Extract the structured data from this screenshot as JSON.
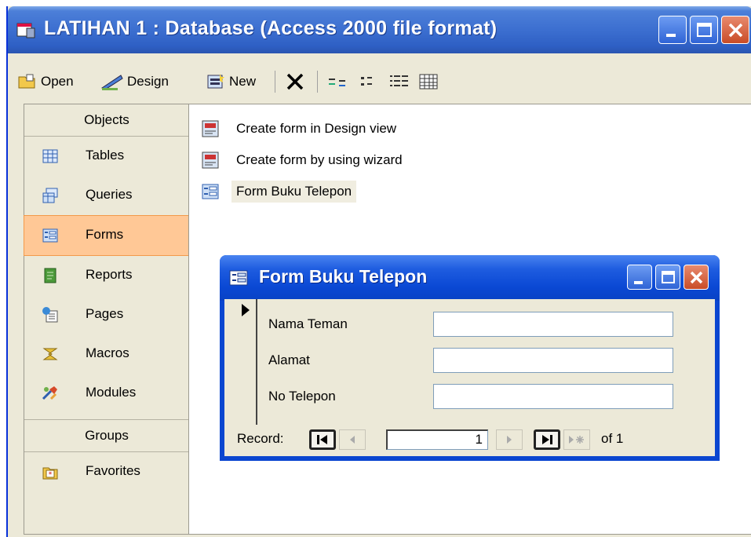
{
  "window": {
    "title": "LATIHAN 1 : Database (Access 2000 file format)"
  },
  "toolbar": {
    "open_label": "Open",
    "design_label": "Design",
    "new_label": "New"
  },
  "objects": {
    "header": "Objects",
    "items": [
      {
        "label": "Tables",
        "icon": "table-icon"
      },
      {
        "label": "Queries",
        "icon": "query-icon"
      },
      {
        "label": "Forms",
        "icon": "form-icon",
        "selected": true
      },
      {
        "label": "Reports",
        "icon": "report-icon"
      },
      {
        "label": "Pages",
        "icon": "page-icon"
      },
      {
        "label": "Macros",
        "icon": "macro-icon"
      },
      {
        "label": "Modules",
        "icon": "module-icon"
      }
    ],
    "groups_header": "Groups",
    "groups": [
      {
        "label": "Favorites",
        "icon": "favorites-folder-icon"
      }
    ]
  },
  "list": {
    "items": [
      {
        "label": "Create form in Design view",
        "icon": "design-wizard-icon"
      },
      {
        "label": "Create form by using wizard",
        "icon": "design-wizard-icon"
      },
      {
        "label": "Form Buku Telepon",
        "icon": "form-icon"
      }
    ]
  },
  "form": {
    "title": "Form Buku Telepon",
    "fields": [
      {
        "label": "Nama Teman",
        "value": ""
      },
      {
        "label": "Alamat",
        "value": ""
      },
      {
        "label": "No Telepon",
        "value": ""
      }
    ],
    "nav": {
      "record_label": "Record:",
      "current": "1",
      "of_label": "of 1"
    }
  },
  "colors": {
    "title_bar": "#2e5fc4",
    "selected_object": "#ffc896",
    "window_bg": "#ece9d8"
  }
}
